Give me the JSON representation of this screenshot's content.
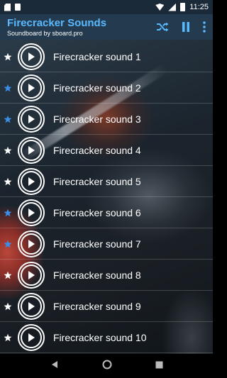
{
  "status_bar": {
    "time": "11:25",
    "icons": [
      "sd-card-icon",
      "notification-icon",
      "wifi-icon",
      "signal-icon",
      "battery-icon"
    ]
  },
  "app_bar": {
    "title": "Firecracker Sounds",
    "subtitle": "Soundboard by sboard.pro",
    "actions": [
      "shuffle-icon",
      "pause-icon",
      "more-vert-icon"
    ],
    "accent_color": "#59b9ff",
    "background_color": "#243b4f"
  },
  "sounds": [
    {
      "label": "Firecracker sound 1",
      "favorite": false
    },
    {
      "label": "Firecracker sound 2",
      "favorite": true
    },
    {
      "label": "Firecracker sound 3",
      "favorite": true
    },
    {
      "label": "Firecracker sound 4",
      "favorite": false
    },
    {
      "label": "Firecracker sound 5",
      "favorite": false
    },
    {
      "label": "Firecracker sound 6",
      "favorite": true
    },
    {
      "label": "Firecracker sound 7",
      "favorite": true
    },
    {
      "label": "Firecracker sound 8",
      "favorite": false
    },
    {
      "label": "Firecracker sound 9",
      "favorite": false
    },
    {
      "label": "Firecracker sound 10",
      "favorite": false
    }
  ],
  "colors": {
    "favorite_star": "#3d8ce6",
    "normal_star": "#ffffff"
  },
  "nav_bar": {
    "buttons": [
      "back-icon",
      "home-icon",
      "recents-icon"
    ]
  }
}
